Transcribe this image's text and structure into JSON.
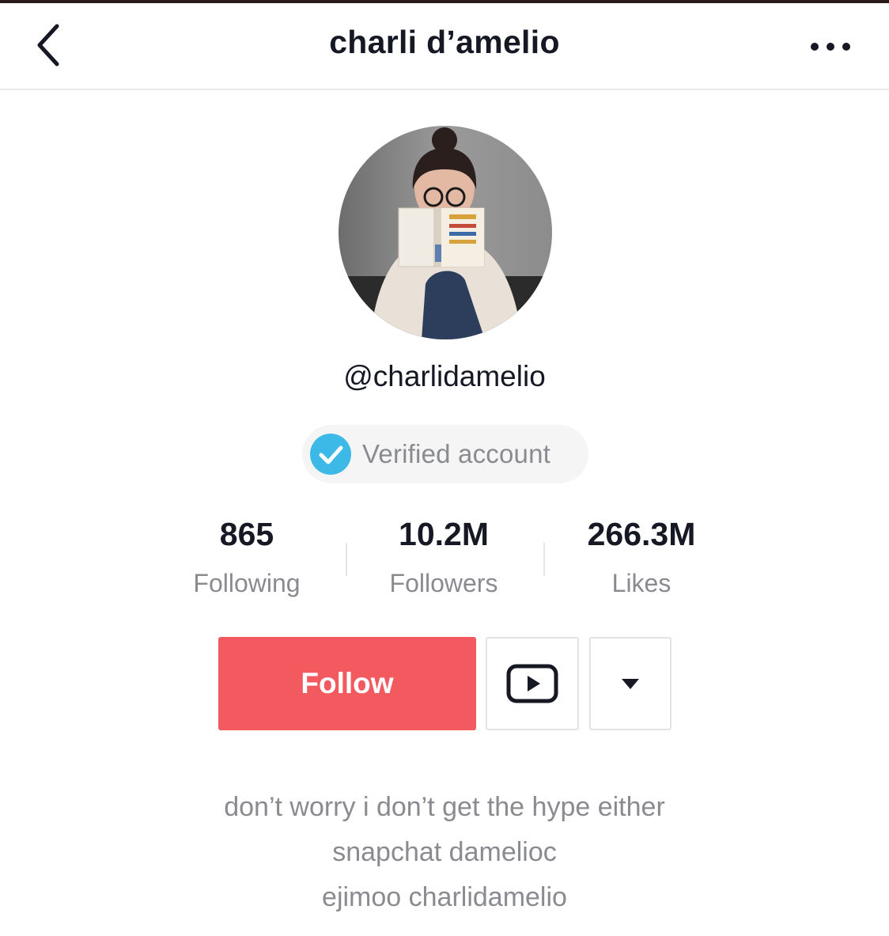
{
  "header": {
    "title": "charli d’amelio"
  },
  "profile": {
    "handle": "@charlidamelio",
    "verified_label": "Verified account",
    "stats": [
      {
        "value": "865",
        "label": "Following"
      },
      {
        "value": "10.2M",
        "label": "Followers"
      },
      {
        "value": "266.3M",
        "label": "Likes"
      }
    ]
  },
  "actions": {
    "follow_label": "Follow"
  },
  "bio": {
    "lines": [
      "don’t worry i don’t get the hype either",
      "snapchat damelioc",
      "ejimoo charlidamelio"
    ]
  },
  "colors": {
    "follow_button": "#f25a5f",
    "verified_badge": "#3cb9e6"
  },
  "icons": [
    "chevron-left-icon",
    "more-dots-icon",
    "verified-check-icon",
    "play-icon",
    "caret-down-icon"
  ]
}
